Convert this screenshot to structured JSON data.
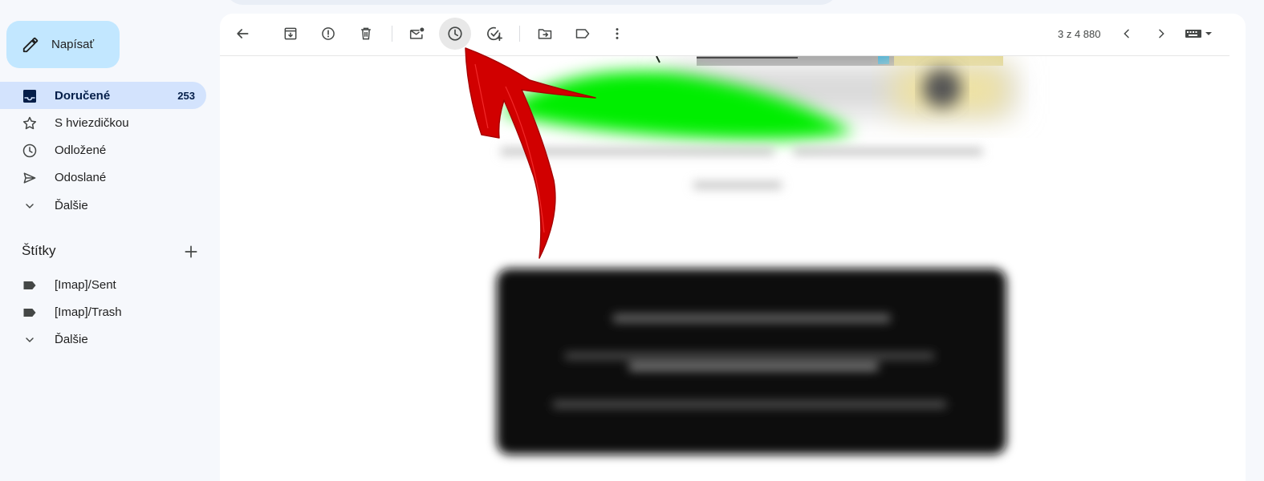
{
  "sidebar": {
    "compose_label": "Napísať",
    "items": [
      {
        "label": "Doručené",
        "count": "253",
        "icon": "inbox-icon"
      },
      {
        "label": "S hviezdičkou",
        "icon": "star-icon"
      },
      {
        "label": "Odložené",
        "icon": "clock-icon"
      },
      {
        "label": "Odoslané",
        "icon": "send-icon"
      },
      {
        "label": "Ďalšie",
        "icon": "chevron-down-icon"
      }
    ],
    "labels_header": "Štítky",
    "labels": [
      {
        "label": "[Imap]/Sent",
        "icon": "label-icon"
      },
      {
        "label": "[Imap]/Trash",
        "icon": "label-icon"
      },
      {
        "label": "Ďalšie",
        "icon": "chevron-down-icon"
      }
    ]
  },
  "toolbar": {
    "buttons": [
      "back-icon",
      "archive-icon",
      "report-spam-icon",
      "delete-icon",
      "mark-unread-icon",
      "snooze-icon",
      "add-task-icon",
      "move-to-icon",
      "label-icon",
      "more-icon"
    ],
    "pager_text": "3 z 4 880",
    "pager_buttons": [
      "chevron-left-icon",
      "chevron-right-icon",
      "keyboard-icon"
    ]
  },
  "colors": {
    "accent": "#c2e7ff",
    "active_nav": "#d3e3fd",
    "annotation_arrow": "#d10000",
    "highlight": "#00ff00",
    "dark_block": "#111111"
  }
}
